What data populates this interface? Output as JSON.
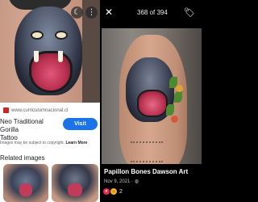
{
  "left": {
    "header_icons": {
      "moon": "moon-icon",
      "more": "more-vertical-icon"
    },
    "source": {
      "domain": "www.curriculumnacional.cl",
      "favicon": "site-favicon"
    },
    "title": "Neo Traditional Gorilla\nTattoo",
    "visit_label": "Visit",
    "copyright_text": "Images may be subject to copyright.",
    "learn_more": "Learn More",
    "related_label": "Related images"
  },
  "right": {
    "close_icon": "close-icon",
    "counter": "368 of 394",
    "tag_icon": "tag-icon",
    "post_title": "Papillon Bones Dawson Art",
    "post_date": "Nov 9, 2021",
    "privacy_icon": "globe-icon",
    "reaction_count": "2"
  },
  "colors": {
    "visit_button": "#1a73e8",
    "heart_reaction": "#f02849",
    "care_reaction": "#f7b125"
  }
}
